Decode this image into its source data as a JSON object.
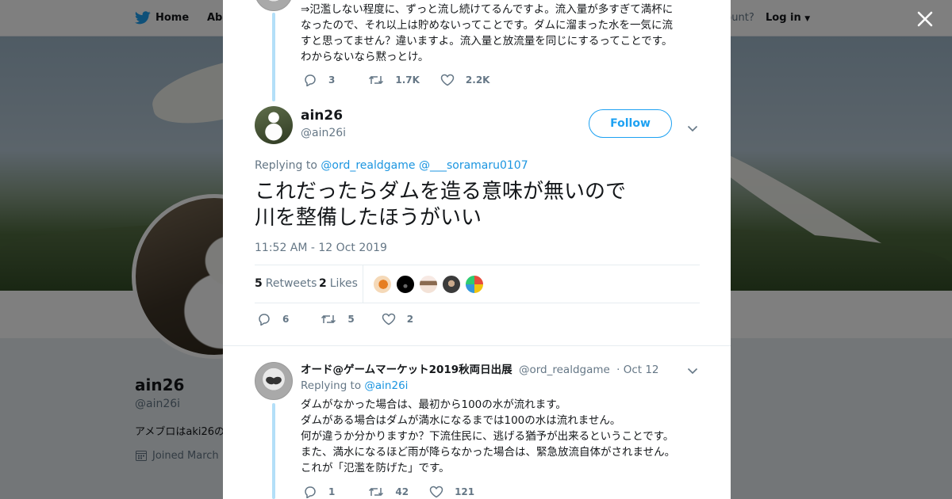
{
  "background": {
    "nav": {
      "home_label": "Home",
      "about_label": "Abo",
      "account_prompt": "ccount?",
      "login_label": "Log in"
    },
    "profile": {
      "name": "ain26",
      "handle": "@ain26i",
      "bio": "アメブロはaki26の",
      "joined": "Joined March"
    }
  },
  "modal": {
    "prev_tweet": {
      "lines": [
        "⇒氾濫しない程度に、ずっと流し続けてるんですよ。流入量が多すぎて満杯に",
        "なったので、それ以上は貯めないってことです。ダムに溜まった水を一気に流",
        "すと思ってません？違いますよ。流入量と放流量を同じにするってことです。",
        "わからないなら黙っとけ。"
      ],
      "replies": "3",
      "retweets": "1.7K",
      "likes": "2.2K"
    },
    "main_tweet": {
      "name": "ain26",
      "handle": "@ain26i",
      "follow_label": "Follow",
      "replying_prefix": "Replying to",
      "replying_to": [
        "@ord_realdgame",
        "@___soramaru0107"
      ],
      "text_lines": [
        "これだったらダムを造る意味が無いので",
        "川を整備したほうがいい"
      ],
      "timestamp": "11:52 AM - 12 Oct 2019",
      "retweet_count": "5",
      "retweet_label": "Retweets",
      "like_count": "2",
      "like_label": "Likes",
      "replies": "6",
      "retweets": "5",
      "likes": "2"
    },
    "reply_tweet": {
      "name": "オード@ゲームマーケット2019秋両日出展",
      "handle": "@ord_realdgame",
      "date": "· Oct 12",
      "replying_prefix": "Replying to",
      "replying_to": "@ain26i",
      "lines": [
        "ダムがなかった場合は、最初から100の水が流れます。",
        "ダムがある場合はダムが満水になるまでは100の水は流れません。",
        "何が違うか分かりますか？下流住民に、逃げる猶予が出来るということです。",
        "また、満水になるほど雨が降らなかった場合は、緊急放流自体がされません。",
        "これが「氾濫を防げた」です。"
      ],
      "replies": "1",
      "retweets": "42",
      "likes": "121"
    }
  },
  "colors": {
    "accent": "#1da1f2",
    "link": "#1b95e0",
    "muted": "#657786",
    "thread_line": "#b3dff8"
  }
}
